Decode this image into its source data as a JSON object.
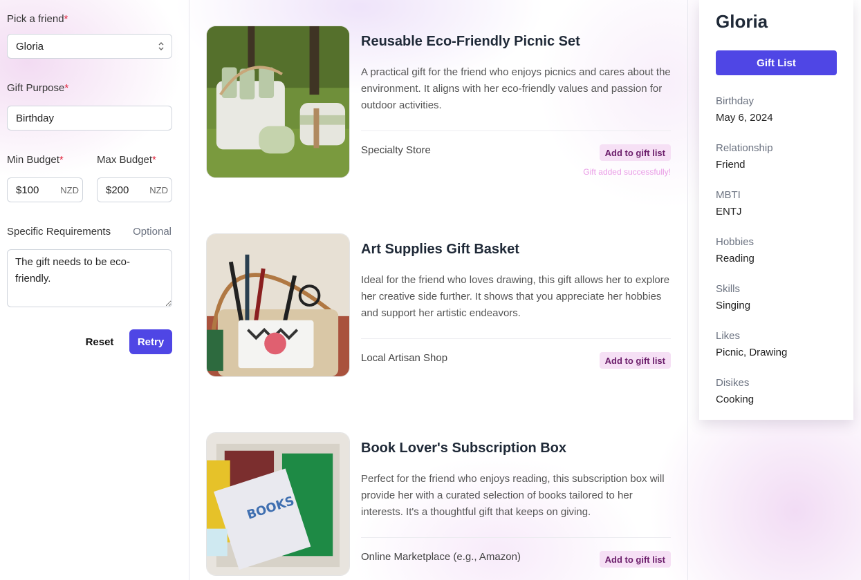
{
  "form": {
    "friend_label": "Pick a friend",
    "friend_value": "Gloria",
    "purpose_label": "Gift Purpose",
    "purpose_value": "Birthday",
    "min_label": "Min Budget",
    "min_value": "$100",
    "max_label": "Max Budget",
    "max_value": "$200",
    "currency": "NZD",
    "required_mark": "*",
    "requirements_label": "Specific Requirements",
    "requirements_optional": "Optional",
    "requirements_value": "The gift needs to be eco-friendly.",
    "reset_label": "Reset",
    "retry_label": "Retry"
  },
  "gifts": [
    {
      "title": "Reusable Eco-Friendly Picnic Set",
      "description": "A practical gift for the friend who enjoys picnics and cares about the environment. It aligns with her eco-friendly values and passion for outdoor activities.",
      "store": "Specialty Store",
      "add_label": "Add to gift list",
      "status": "Gift added successfully!"
    },
    {
      "title": "Art Supplies Gift Basket",
      "description": "Ideal for the friend who loves drawing, this gift allows her to explore her creative side further. It shows that you appreciate her hobbies and support her artistic endeavors.",
      "store": "Local Artisan Shop",
      "add_label": "Add to gift list"
    },
    {
      "title": "Book Lover's Subscription Box",
      "description": "Perfect for the friend who enjoys reading, this subscription box will provide her with a curated selection of books tailored to her interests. It's a thoughtful gift that keeps on giving.",
      "store": "Online Marketplace (e.g., Amazon)",
      "add_label": "Add to gift list"
    }
  ],
  "profile": {
    "name": "Gloria",
    "gift_list_label": "Gift List",
    "attributes": [
      {
        "label": "Birthday",
        "value": "May 6, 2024"
      },
      {
        "label": "Relationship",
        "value": "Friend"
      },
      {
        "label": "MBTI",
        "value": "ENTJ"
      },
      {
        "label": "Hobbies",
        "value": "Reading"
      },
      {
        "label": "Skills",
        "value": "Singing"
      },
      {
        "label": "Likes",
        "value": "Picnic, Drawing"
      },
      {
        "label": "Disikes",
        "value": "Cooking"
      }
    ]
  },
  "colors": {
    "accent": "#4f46e5",
    "add_button_bg": "#f6e0f5",
    "add_button_text": "#6b1d6a",
    "success_text": "#e99be6",
    "required": "#e0243c"
  },
  "icons": {
    "select_caret": "chevron-up-down-icon"
  }
}
